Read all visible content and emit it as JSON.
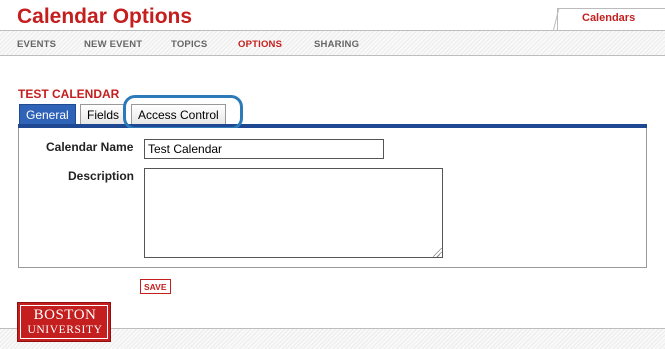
{
  "header": {
    "title": "Calendar Options",
    "calendars_link": "Calendars"
  },
  "nav": {
    "items": [
      "EVENTS",
      "NEW EVENT",
      "TOPICS",
      "OPTIONS",
      "SHARING"
    ],
    "active": "OPTIONS"
  },
  "calendar": {
    "heading": "TEST CALENDAR"
  },
  "tabs": {
    "items": [
      "General",
      "Fields",
      "Access Control"
    ],
    "active": "General",
    "highlighted": "Access Control"
  },
  "form": {
    "name_label": "Calendar Name",
    "name_value": "Test Calendar",
    "description_label": "Description",
    "description_value": ""
  },
  "save_label": "SAVE",
  "logo": {
    "line1": "BOSTON",
    "line2": "UNIVERSITY"
  },
  "colors": {
    "brand_red": "#c41e1e",
    "tab_blue": "#2e63b7",
    "highlight_ring": "#2c7bb8"
  }
}
